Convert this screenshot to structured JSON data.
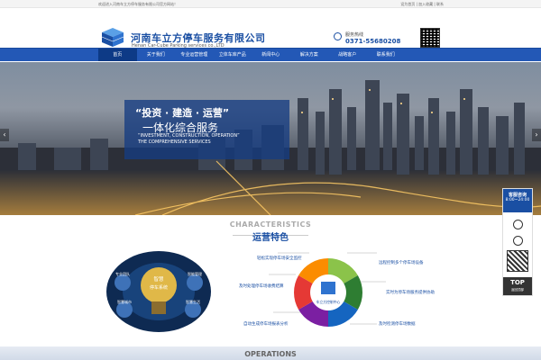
{
  "topbar": {
    "welcome": "欢迎进入河南车立方停车服务有限公司官方网站！",
    "links": "设为首页 | 加入收藏 | 联系"
  },
  "header": {
    "company_cn": "河南车立方停车服务有限公司",
    "company_en": "Henan Car-Cube Parking services co.,LTD",
    "hotline_label": "服务热线",
    "hotline_number": "0371-55680208"
  },
  "nav": {
    "items": [
      {
        "label": "首页",
        "active": true
      },
      {
        "label": "关于我们"
      },
      {
        "label": "专业运营管理"
      },
      {
        "label": "立体车库产品"
      },
      {
        "label": "新闻中心"
      },
      {
        "label": "解决方案"
      },
      {
        "label": "战略客户"
      },
      {
        "label": "联系我们"
      }
    ]
  },
  "banner": {
    "slogan_line1": "“投资 · 建造 · 运营”",
    "slogan_line2": "一体化综合服务",
    "slogan_en1": "“INVESTMENT, CONSTRUCTION, OPERATION”",
    "slogan_en2": "THE COMPREHENSIVE SERVICES",
    "prev": "‹",
    "next": "›"
  },
  "characteristics": {
    "title_en": "CHARACTERISTICS",
    "title_cn": "运营特色",
    "bulb_labels": [
      "智慧",
      "停车系统",
      "智能管理",
      "专业团队",
      "智慧城市",
      "智慧生活"
    ],
    "center_label": "车立方控制中心",
    "features": [
      "轻松实现停车场安全监控",
      "远程控制多个停车场设备",
      "及时处理停车场收费结算",
      "实时为停车场服务提供协助",
      "自动生成停车场报表分析",
      "及时检测停车场数据"
    ],
    "segment_colors": [
      "#8bc34a",
      "#2e7d32",
      "#1565c0",
      "#7b1fa2",
      "#e53935",
      "#fb8c00"
    ]
  },
  "operations": {
    "title_en": "OPERATIONS"
  },
  "side_float": {
    "title": "客服咨询",
    "hours": "8:00~24:00",
    "top": "TOP",
    "top_sub": "返回顶部"
  }
}
